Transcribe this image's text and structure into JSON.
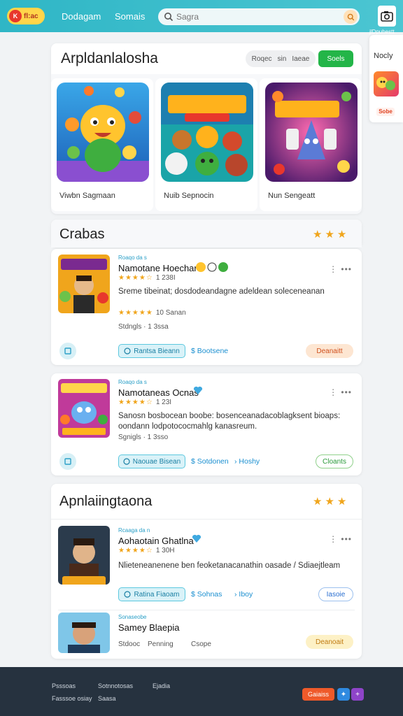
{
  "header": {
    "logo_mark": "K",
    "logo_text": "fl:ac",
    "nav": [
      "Dodagam",
      "Somais"
    ],
    "search": {
      "placeholder": "Sagra"
    },
    "camera_label": "jlDpuhestt"
  },
  "side_panel": {
    "title": "Nocly",
    "badge": "Sobe"
  },
  "featured": {
    "title": "Arpldanlalosha",
    "filter_label_a": "Roqec",
    "filter_label_b": "sin",
    "filter_label_c": "Iaeae",
    "action_label": "Soels",
    "games": [
      {
        "name": "Viwbn Sagmaan",
        "art": "cute-monster"
      },
      {
        "name": "Nuib Sepnocin",
        "art": "characters-poster"
      },
      {
        "name": "Nun Sengeatt",
        "art": "monsters-poster"
      }
    ]
  },
  "section1": {
    "title": "Crabas",
    "items": [
      {
        "tag": "Roaqo da s",
        "title": "Namotane Hoechar",
        "rating_stars": "★★★★☆",
        "rating_count": "1 238I",
        "desc": "Sreme tibeinat; dosdodeandagne adeldean soleceneanan",
        "sub_stars": "★★★★★",
        "sub_text": "10 Sanan",
        "meta": "Stdngls · 1 3ssa",
        "play_label": "Rantsa Bieann",
        "link_label": "Bootsene",
        "pill_label": "Deanaitt",
        "pill_style": "orange"
      },
      {
        "tag": "Roaqo da s",
        "title": "Namotaneas Ocnas",
        "rating_stars": "★★★★☆",
        "rating_count": "1 23I",
        "desc": "Sanosn bosbocean boobe: bosenceanadacoblagksent bioaps: oondann lodpotococmahlg kanasreum.",
        "meta": "Sgnigls · 1 3sso",
        "play_label": "Naouae Bisean",
        "link_label": "Sotdonen",
        "link2_label": "Hoshy",
        "pill_label": "Cloants",
        "pill_style": "green"
      }
    ]
  },
  "section2": {
    "title": "Apnlaiingtaona",
    "items": [
      {
        "tag": "Rcaaga da n",
        "title": "Aohaotain Ghatlna",
        "rating_stars": "★★★★☆",
        "rating_count": "1 30H",
        "desc": "Nlieteneanenene ben feoketanacanathin oasade / Sdiaejtleam",
        "play_label": "Ratina Fiaoam",
        "link_label": "Sohnas",
        "link2_label": "Iboy",
        "pill_label": "Iasoie",
        "pill_style": "blue"
      },
      {
        "tag": "Sonaseobe",
        "title": "Samey Blaepia",
        "meta_a": "Stdooc",
        "meta_b": "Penning",
        "meta_c": "Csope",
        "pill_label": "Deanoait",
        "pill_style": "yellow"
      }
    ]
  },
  "footer": {
    "links": [
      "Psssoas",
      "Sotnnotosas",
      "Ejadia",
      "Fasssoe osiay",
      "Saasa"
    ],
    "button_label": "Gaiaiss"
  },
  "colors": {
    "topbar": "#2fb6c6",
    "accent_green": "#23b548",
    "star": "#f0a51c",
    "footer": "#26323f"
  }
}
